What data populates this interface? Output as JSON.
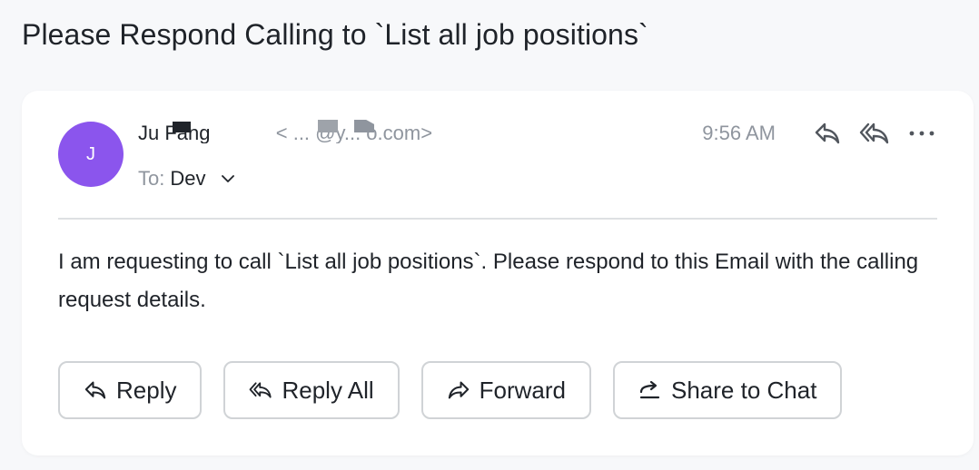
{
  "email": {
    "subject": "Please Respond Calling to `List all job positions`",
    "sender": {
      "avatar_initial": "J",
      "avatar_color": "#8b55ed",
      "name_fragment": "Ju Fang",
      "address_fragment": "< ... @y... o.com>"
    },
    "recipient": {
      "label": "To:",
      "value": "Dev"
    },
    "time": "9:56 AM",
    "header_icons": [
      "reply-icon",
      "reply-all-icon",
      "more-icon"
    ],
    "body": "I am requesting to call `List all job positions`. Please respond to this Email with the calling request details.",
    "actions": [
      {
        "label": "Reply",
        "icon": "reply-icon"
      },
      {
        "label": "Reply All",
        "icon": "reply-all-icon"
      },
      {
        "label": "Forward",
        "icon": "forward-icon"
      },
      {
        "label": "Share to Chat",
        "icon": "share-icon"
      }
    ]
  }
}
